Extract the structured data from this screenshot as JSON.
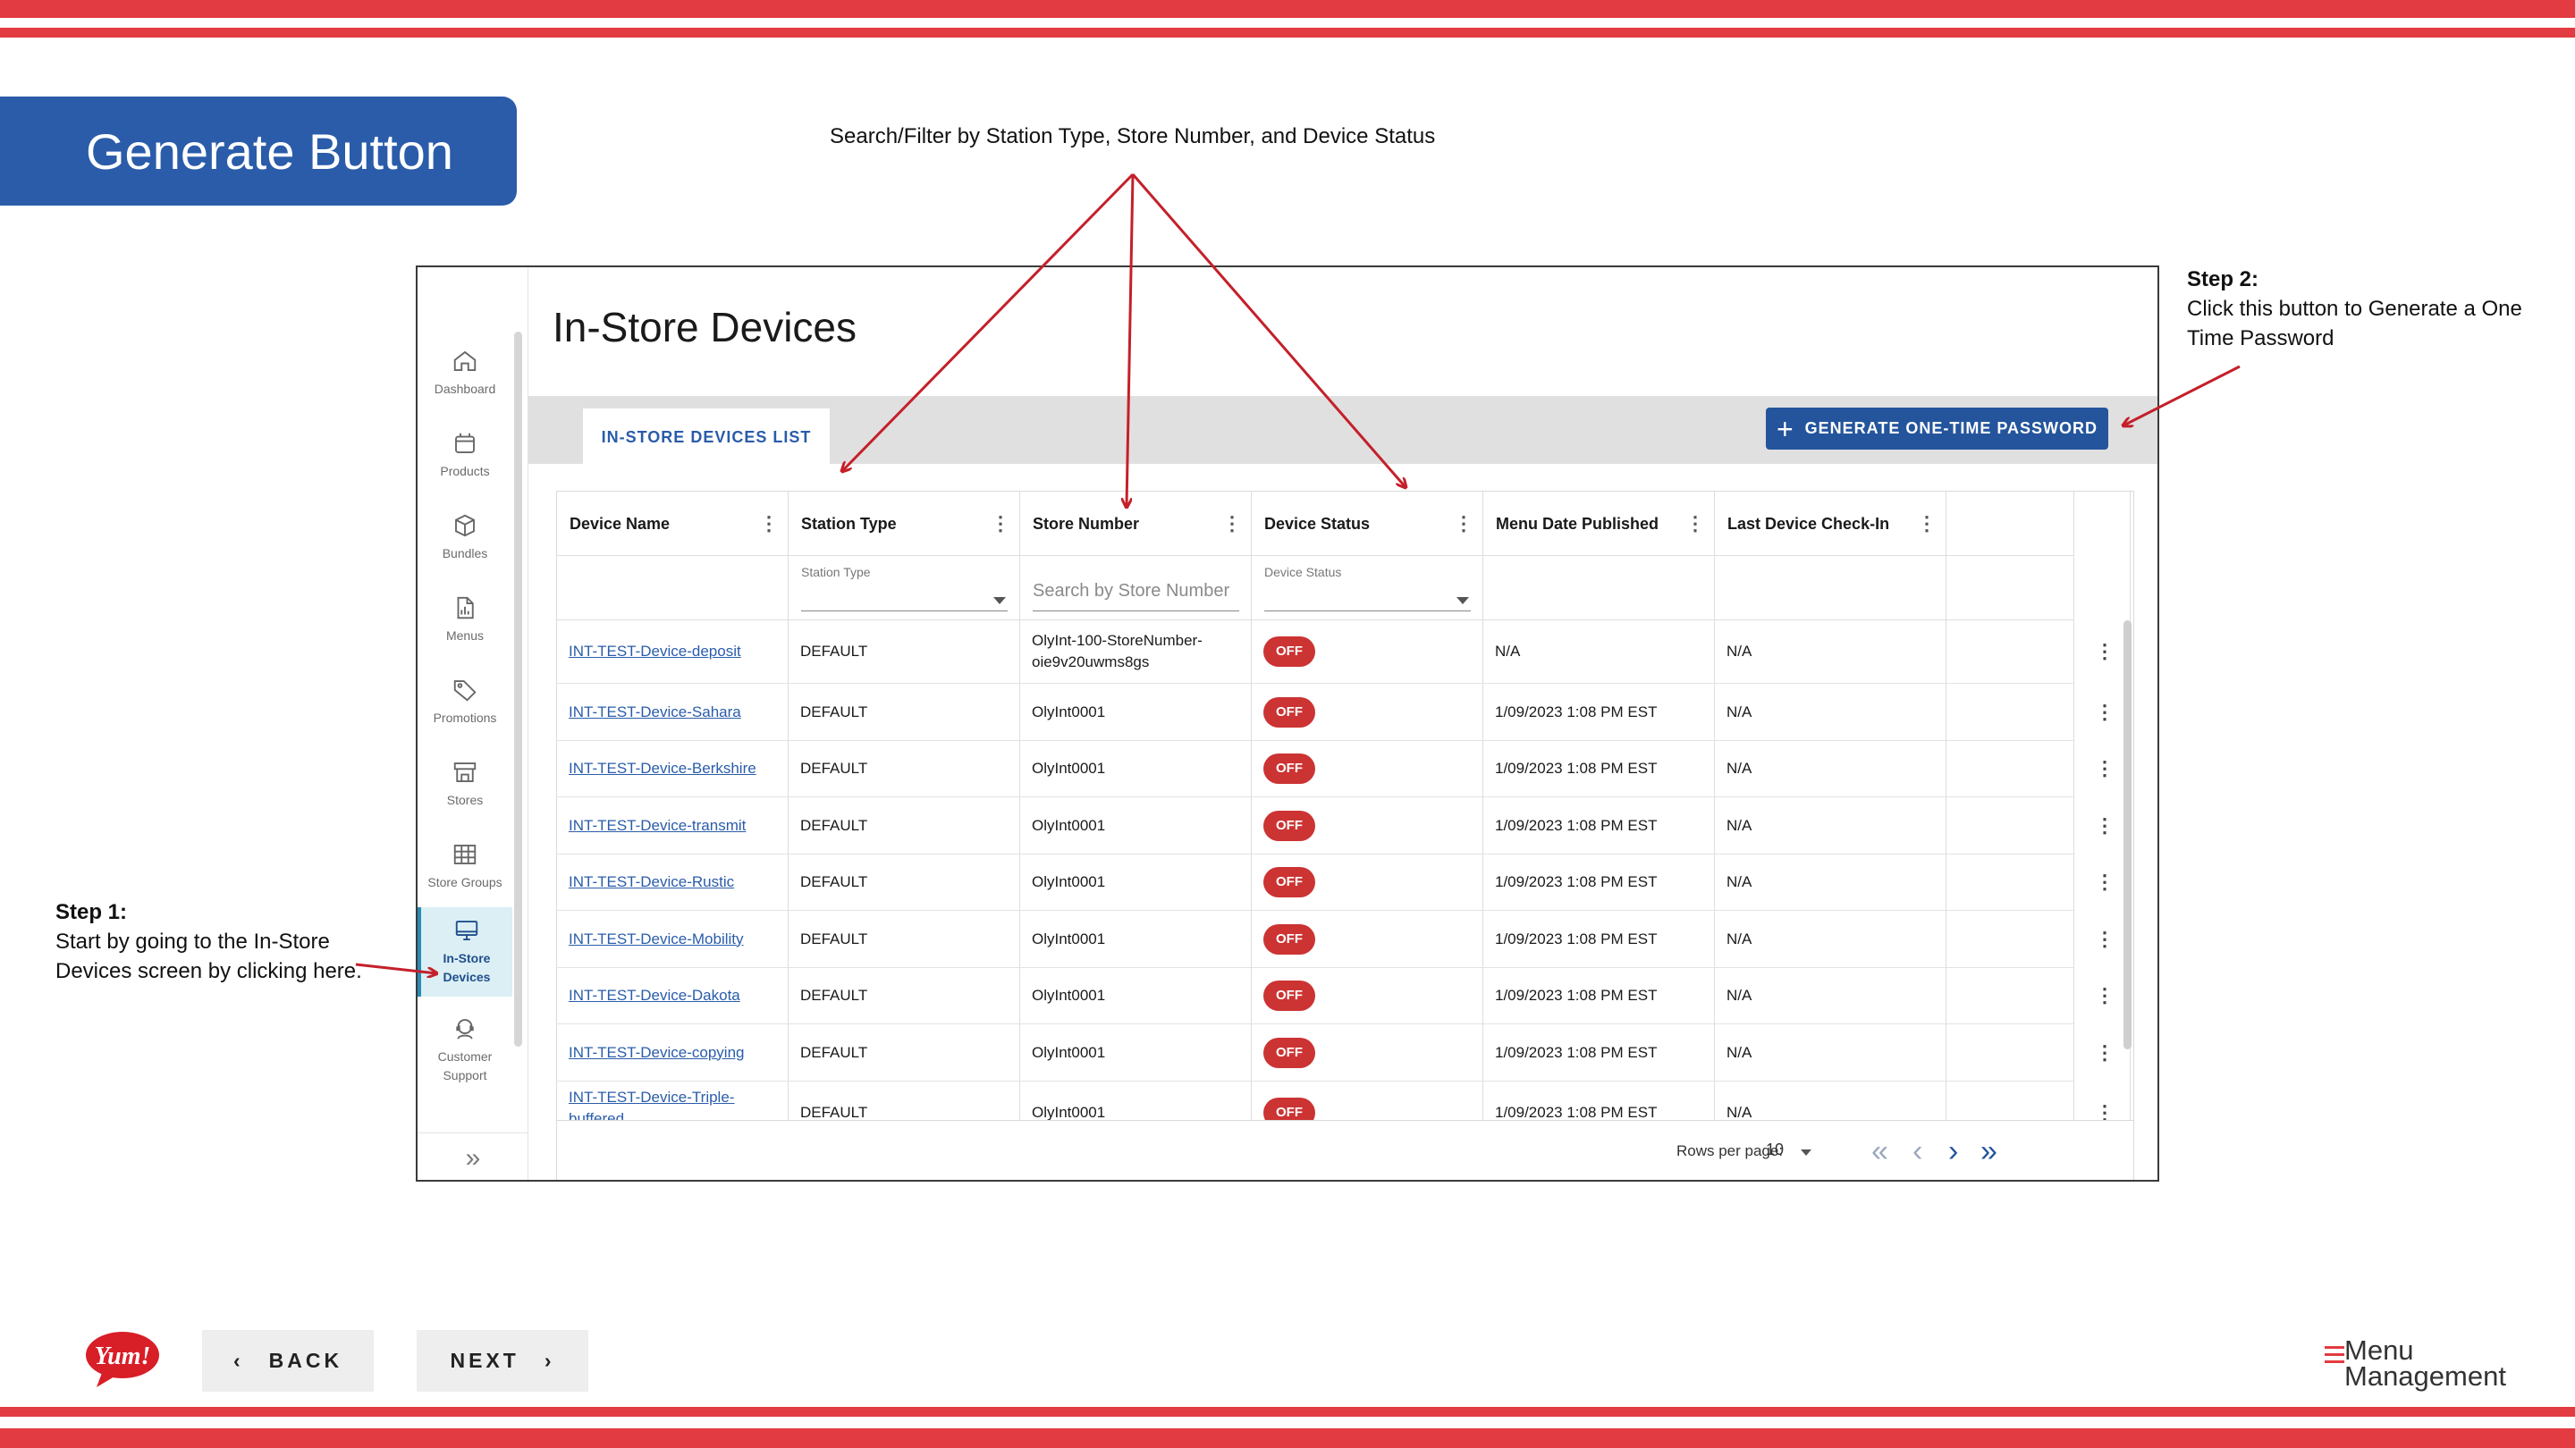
{
  "slide": {
    "title": "Generate Button",
    "top_annotation": "Search/Filter by Station Type, Store Number, and Device Status",
    "step1": {
      "heading": "Step 1:",
      "text": "Start by going to the In-Store Devices screen by clicking here."
    },
    "step2": {
      "heading": "Step 2:",
      "text": "Click this button to Generate a One Time Password"
    },
    "back_label": "BACK",
    "next_label": "NEXT",
    "brand_logo": "Yum!",
    "product_logo": {
      "line1": "Menu",
      "line2": "Management"
    },
    "accent_color": "#e23b41",
    "title_color": "#2a5caa"
  },
  "app": {
    "page_title": "In-Store Devices",
    "sidebar": [
      {
        "label": "Dashboard",
        "icon": "home-icon"
      },
      {
        "label": "Products",
        "icon": "box-icon"
      },
      {
        "label": "Bundles",
        "icon": "cube-icon"
      },
      {
        "label": "Menus",
        "icon": "document-chart-icon"
      },
      {
        "label": "Promotions",
        "icon": "tag-icon"
      },
      {
        "label": "Stores",
        "icon": "storefront-icon"
      },
      {
        "label": "Store Groups",
        "icon": "grid-icon"
      },
      {
        "label": "In-Store Devices",
        "icon": "monitor-icon",
        "active": true
      },
      {
        "label": "Customer Support",
        "icon": "headset-icon"
      }
    ],
    "tab_label": "IN-STORE DEVICES LIST",
    "generate_label": "GENERATE ONE-TIME PASSWORD",
    "columns": [
      "Device Name",
      "Station Type",
      "Store Number",
      "Device Status",
      "Menu Date Published",
      "Last Device Check-In"
    ],
    "filters": {
      "station_type_label": "Station Type",
      "store_number_placeholder": "Search by Store Number",
      "device_status_label": "Device Status"
    },
    "rows": [
      {
        "name": "INT-TEST-Device-deposit",
        "station": "DEFAULT",
        "store": "OlyInt-100-StoreNumber-oie9v20uwms8gs",
        "status": "OFF",
        "published": "N/A",
        "checkin": "N/A"
      },
      {
        "name": "INT-TEST-Device-Sahara",
        "station": "DEFAULT",
        "store": "OlyInt0001",
        "status": "OFF",
        "published": "1/09/2023 1:08 PM EST",
        "checkin": "N/A"
      },
      {
        "name": "INT-TEST-Device-Berkshire",
        "station": "DEFAULT",
        "store": "OlyInt0001",
        "status": "OFF",
        "published": "1/09/2023 1:08 PM EST",
        "checkin": "N/A"
      },
      {
        "name": "INT-TEST-Device-transmit",
        "station": "DEFAULT",
        "store": "OlyInt0001",
        "status": "OFF",
        "published": "1/09/2023 1:08 PM EST",
        "checkin": "N/A"
      },
      {
        "name": "INT-TEST-Device-Rustic",
        "station": "DEFAULT",
        "store": "OlyInt0001",
        "status": "OFF",
        "published": "1/09/2023 1:08 PM EST",
        "checkin": "N/A"
      },
      {
        "name": "INT-TEST-Device-Mobility",
        "station": "DEFAULT",
        "store": "OlyInt0001",
        "status": "OFF",
        "published": "1/09/2023 1:08 PM EST",
        "checkin": "N/A"
      },
      {
        "name": "INT-TEST-Device-Dakota",
        "station": "DEFAULT",
        "store": "OlyInt0001",
        "status": "OFF",
        "published": "1/09/2023 1:08 PM EST",
        "checkin": "N/A"
      },
      {
        "name": "INT-TEST-Device-copying",
        "station": "DEFAULT",
        "store": "OlyInt0001",
        "status": "OFF",
        "published": "1/09/2023 1:08 PM EST",
        "checkin": "N/A"
      },
      {
        "name": "INT-TEST-Device-Triple-buffered",
        "station": "DEFAULT",
        "store": "OlyInt0001",
        "status": "OFF",
        "published": "1/09/2023 1:08 PM EST",
        "checkin": "N/A"
      }
    ],
    "pagination": {
      "rows_per_page_label": "Rows per page:",
      "rows_per_page": "10"
    }
  }
}
